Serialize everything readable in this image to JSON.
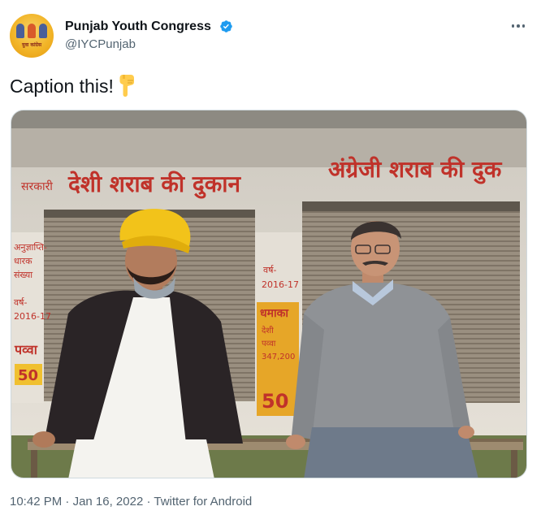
{
  "author": {
    "name": "Punjab Youth Congress",
    "handle": "@IYCPunjab",
    "verified": true,
    "avatar_text": "युवा कांग्रेस"
  },
  "tweet": {
    "text": "Caption this!",
    "emoji": "backhand-index-pointing-down",
    "media": {
      "sign_left": "सरकारी देशी शराब की दुकान",
      "sign_right": "अंग्रेजी शराब की दुक",
      "panel_left_lines": [
        "अनुज्ञाप्ति-",
        "धारक",
        "संख्या",
        "",
        "वर्ष-",
        "2016-17"
      ],
      "panel_left_pawwa": "पव्वा",
      "panel_left_price": "50",
      "panel_mid_year_label": "वर्ष-",
      "panel_mid_year": "2016-17",
      "panel_mid_top": "धमाका",
      "panel_mid_lines": [
        "देशी",
        "पव्वा",
        "347,200"
      ],
      "panel_mid_price": "50"
    }
  },
  "footer": {
    "time": "10:42 PM",
    "separator": "·",
    "date": "Jan 16, 2022",
    "source": "Twitter for Android"
  },
  "colors": {
    "verified_blue": "#1d9bf0",
    "secondary_text": "#536471",
    "primary_text": "#0f1419",
    "turban": "#f2c31a",
    "sign_red": "#c0322a"
  }
}
